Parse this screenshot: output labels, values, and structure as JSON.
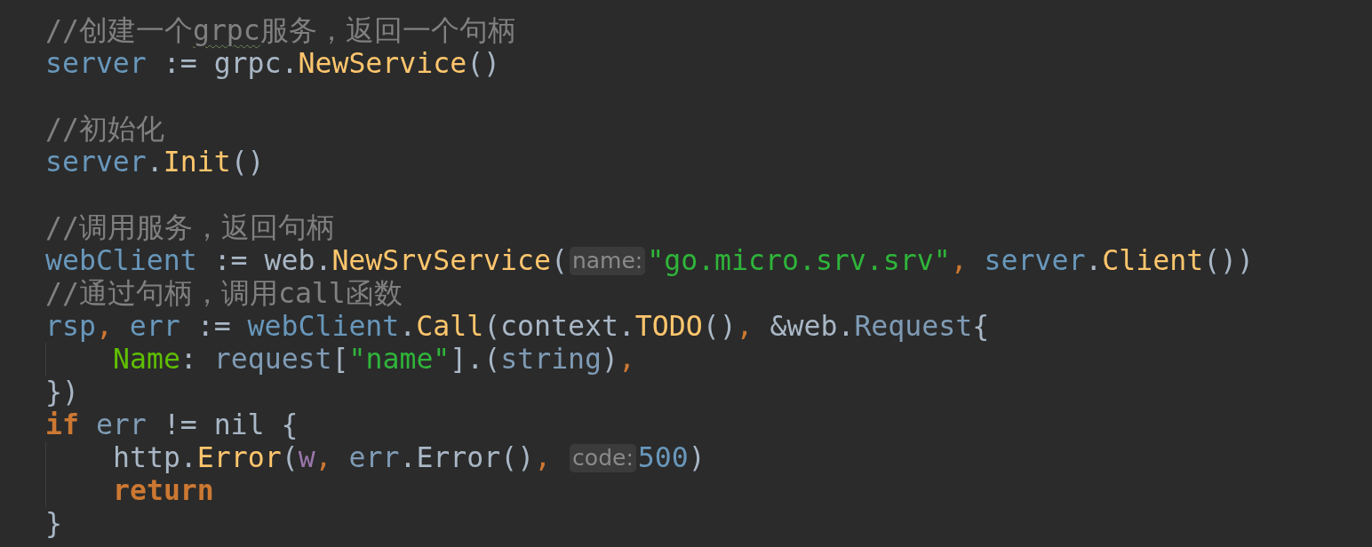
{
  "editor": {
    "lines": [
      {
        "kind": "plain",
        "tokens": [
          {
            "kind": "comment",
            "text": "//创建一个"
          },
          {
            "kind": "comment-typo",
            "text": "grpc"
          },
          {
            "kind": "comment",
            "text": "服务，返回一个句柄"
          }
        ]
      },
      {
        "kind": "plain",
        "tokens": [
          {
            "kind": "var",
            "text": "server"
          },
          {
            "kind": "plain",
            "text": " := grpc."
          },
          {
            "kind": "func",
            "text": "NewService"
          },
          {
            "kind": "plain",
            "text": "()"
          }
        ]
      },
      {
        "kind": "blank"
      },
      {
        "kind": "plain",
        "tokens": [
          {
            "kind": "comment",
            "text": "//初始化"
          }
        ]
      },
      {
        "kind": "plain",
        "tokens": [
          {
            "kind": "var",
            "text": "server"
          },
          {
            "kind": "plain",
            "text": "."
          },
          {
            "kind": "func",
            "text": "Init"
          },
          {
            "kind": "plain",
            "text": "()"
          }
        ]
      },
      {
        "kind": "blank"
      },
      {
        "kind": "plain",
        "tokens": [
          {
            "kind": "comment",
            "text": "//调用服务，返回句柄"
          }
        ]
      },
      {
        "kind": "plain",
        "tokens": [
          {
            "kind": "var",
            "text": "webClient"
          },
          {
            "kind": "plain",
            "text": " := web."
          },
          {
            "kind": "func",
            "text": "NewSrvService"
          },
          {
            "kind": "plain",
            "text": "("
          },
          {
            "kind": "hint",
            "text": "name:"
          },
          {
            "kind": "string",
            "text": "\"go.micro.srv.srv\""
          },
          {
            "kind": "comma",
            "text": ", "
          },
          {
            "kind": "var",
            "text": "server"
          },
          {
            "kind": "plain",
            "text": "."
          },
          {
            "kind": "func",
            "text": "Client"
          },
          {
            "kind": "plain",
            "text": "())"
          }
        ]
      },
      {
        "kind": "plain",
        "tokens": [
          {
            "kind": "comment",
            "text": "//通过句柄，调用"
          },
          {
            "kind": "comment-code",
            "text": "call"
          },
          {
            "kind": "comment",
            "text": "函数"
          }
        ]
      },
      {
        "kind": "plain",
        "tokens": [
          {
            "kind": "var",
            "text": "rsp"
          },
          {
            "kind": "comma",
            "text": ", "
          },
          {
            "kind": "var",
            "text": "err"
          },
          {
            "kind": "plain",
            "text": " := "
          },
          {
            "kind": "var",
            "text": "webClient"
          },
          {
            "kind": "plain",
            "text": "."
          },
          {
            "kind": "func",
            "text": "Call"
          },
          {
            "kind": "plain",
            "text": "(context."
          },
          {
            "kind": "func",
            "text": "TODO"
          },
          {
            "kind": "plain",
            "text": "()"
          },
          {
            "kind": "comma",
            "text": ", "
          },
          {
            "kind": "plain",
            "text": "&web."
          },
          {
            "kind": "type",
            "text": "Request"
          },
          {
            "kind": "plain",
            "text": "{"
          }
        ]
      },
      {
        "kind": "indented",
        "tokens": [
          {
            "kind": "field",
            "text": "Name"
          },
          {
            "kind": "plain",
            "text": ": "
          },
          {
            "kind": "type",
            "text": "request"
          },
          {
            "kind": "plain",
            "text": "["
          },
          {
            "kind": "string",
            "text": "\"name\""
          },
          {
            "kind": "plain",
            "text": "].("
          },
          {
            "kind": "type",
            "text": "string"
          },
          {
            "kind": "plain",
            "text": ")"
          },
          {
            "kind": "comma",
            "text": ","
          }
        ]
      },
      {
        "kind": "plain",
        "tokens": [
          {
            "kind": "plain",
            "text": "})"
          }
        ]
      },
      {
        "kind": "plain",
        "tokens": [
          {
            "kind": "keyword",
            "text": "if"
          },
          {
            "kind": "type",
            "text": " err"
          },
          {
            "kind": "plain",
            "text": " != nil {"
          }
        ]
      },
      {
        "kind": "indented",
        "tokens": [
          {
            "kind": "plain",
            "text": "http."
          },
          {
            "kind": "func",
            "text": "Error"
          },
          {
            "kind": "plain",
            "text": "("
          },
          {
            "kind": "param",
            "text": "w"
          },
          {
            "kind": "comma",
            "text": ", "
          },
          {
            "kind": "type",
            "text": "err"
          },
          {
            "kind": "plain",
            "text": ".Error()"
          },
          {
            "kind": "comma",
            "text": ", "
          },
          {
            "kind": "hint",
            "text": "code:"
          },
          {
            "kind": "number",
            "text": "500"
          },
          {
            "kind": "plain",
            "text": ")"
          }
        ]
      },
      {
        "kind": "indented",
        "tokens": [
          {
            "kind": "keyword",
            "text": "return"
          }
        ]
      },
      {
        "kind": "plain",
        "tokens": [
          {
            "kind": "plain",
            "text": "}"
          }
        ]
      }
    ]
  }
}
